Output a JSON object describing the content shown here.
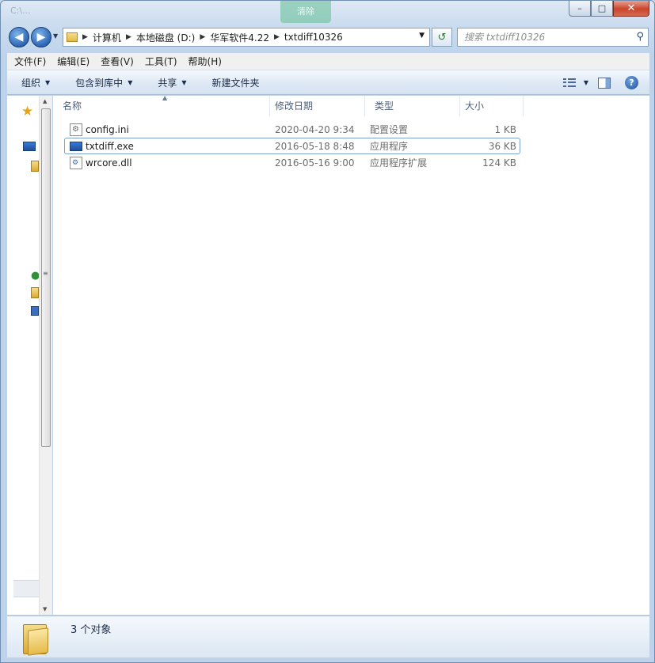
{
  "window": {
    "title_ghost": "C:\\...",
    "green_button": "清除",
    "controls": {
      "minimize": "–",
      "maximize": "□",
      "close": "✕"
    }
  },
  "address": {
    "crumbs": [
      "计算机",
      "本地磁盘 (D:)",
      "华军软件4.22",
      "txtdiff10326"
    ]
  },
  "search": {
    "placeholder": "搜索 txtdiff10326"
  },
  "menu": [
    "文件(F)",
    "编辑(E)",
    "查看(V)",
    "工具(T)",
    "帮助(H)"
  ],
  "toolbar": {
    "organize": "组织",
    "include_library": "包含到库中",
    "share": "共享",
    "new_folder": "新建文件夹"
  },
  "columns": {
    "name": "名称",
    "date": "修改日期",
    "type": "类型",
    "size": "大小"
  },
  "files": [
    {
      "name": "config.ini",
      "date": "2020-04-20 9:34",
      "type": "配置设置",
      "size": "1 KB",
      "icon": "ini-file-icon"
    },
    {
      "name": "txtdiff.exe",
      "date": "2016-05-18 8:48",
      "type": "应用程序",
      "size": "36 KB",
      "icon": "exe-file-icon"
    },
    {
      "name": "wrcore.dll",
      "date": "2016-05-16 9:00",
      "type": "应用程序扩展",
      "size": "124 KB",
      "icon": "dll-file-icon"
    }
  ],
  "details": {
    "count": "3 个对象"
  }
}
